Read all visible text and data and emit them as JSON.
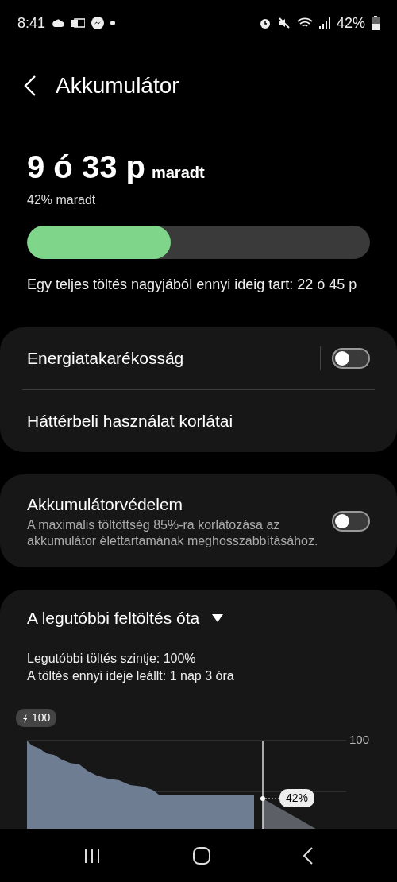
{
  "status_bar": {
    "time": "8:41",
    "battery": "42%"
  },
  "header": {
    "title": "Akkumulátor"
  },
  "summary": {
    "remaining_time": "9 ó 33 p",
    "remaining_suffix": "maradt",
    "percent_text": "42% maradt",
    "level": 0.42,
    "full_charge_text": "Egy teljes töltés nagyjából ennyi ideig tart: 22 ó 45 p"
  },
  "settings_group": {
    "items": [
      {
        "kind": "toggle",
        "label": "Energiatakarékosság",
        "on": false
      },
      {
        "kind": "link",
        "label": "Háttérbeli használat korlátai"
      }
    ]
  },
  "protection": {
    "title": "Akkumulátorvédelem",
    "description": "A maximális töltöttség 85%-ra korlátozása az akkumulátor élettartamának meghosszabbításához.",
    "on": false
  },
  "history": {
    "title": "A legutóbbi feltöltés óta",
    "lines": [
      "Legutóbbi töltés szintje: 100%",
      "A töltés ennyi ideje leállt: 1 nap 3 óra"
    ],
    "chart": {
      "start_badge": "100",
      "axis_label": "100",
      "current_label": "42%"
    }
  }
}
